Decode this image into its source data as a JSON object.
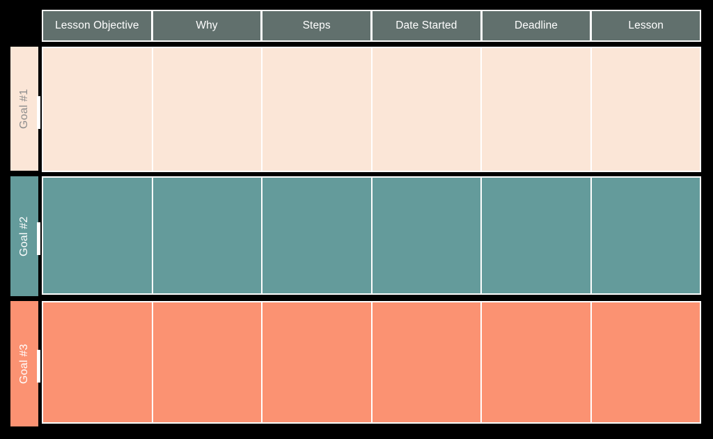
{
  "board": {
    "background_color": "#000000",
    "header": {
      "background_color": "#61706D",
      "text_color": "#FFFFFF",
      "columns": [
        {
          "label": "Lesson Objective"
        },
        {
          "label": "Why"
        },
        {
          "label": "Steps"
        },
        {
          "label": "Date Started"
        },
        {
          "label": "Deadline"
        },
        {
          "label": "Lesson"
        }
      ]
    },
    "rows": [
      {
        "label": "Goal #1",
        "fill_color": "#FBE6D7",
        "text_color": "#8C8C8C",
        "cells": [
          "",
          "",
          "",
          "",
          "",
          ""
        ]
      },
      {
        "label": "Goal #2",
        "fill_color": "#649B9B",
        "text_color": "#FFFFFF",
        "cells": [
          "",
          "",
          "",
          "",
          "",
          ""
        ]
      },
      {
        "label": "Goal #3",
        "fill_color": "#FB9272",
        "text_color": "#FFFFFF",
        "cells": [
          "",
          "",
          "",
          "",
          "",
          ""
        ]
      }
    ]
  }
}
